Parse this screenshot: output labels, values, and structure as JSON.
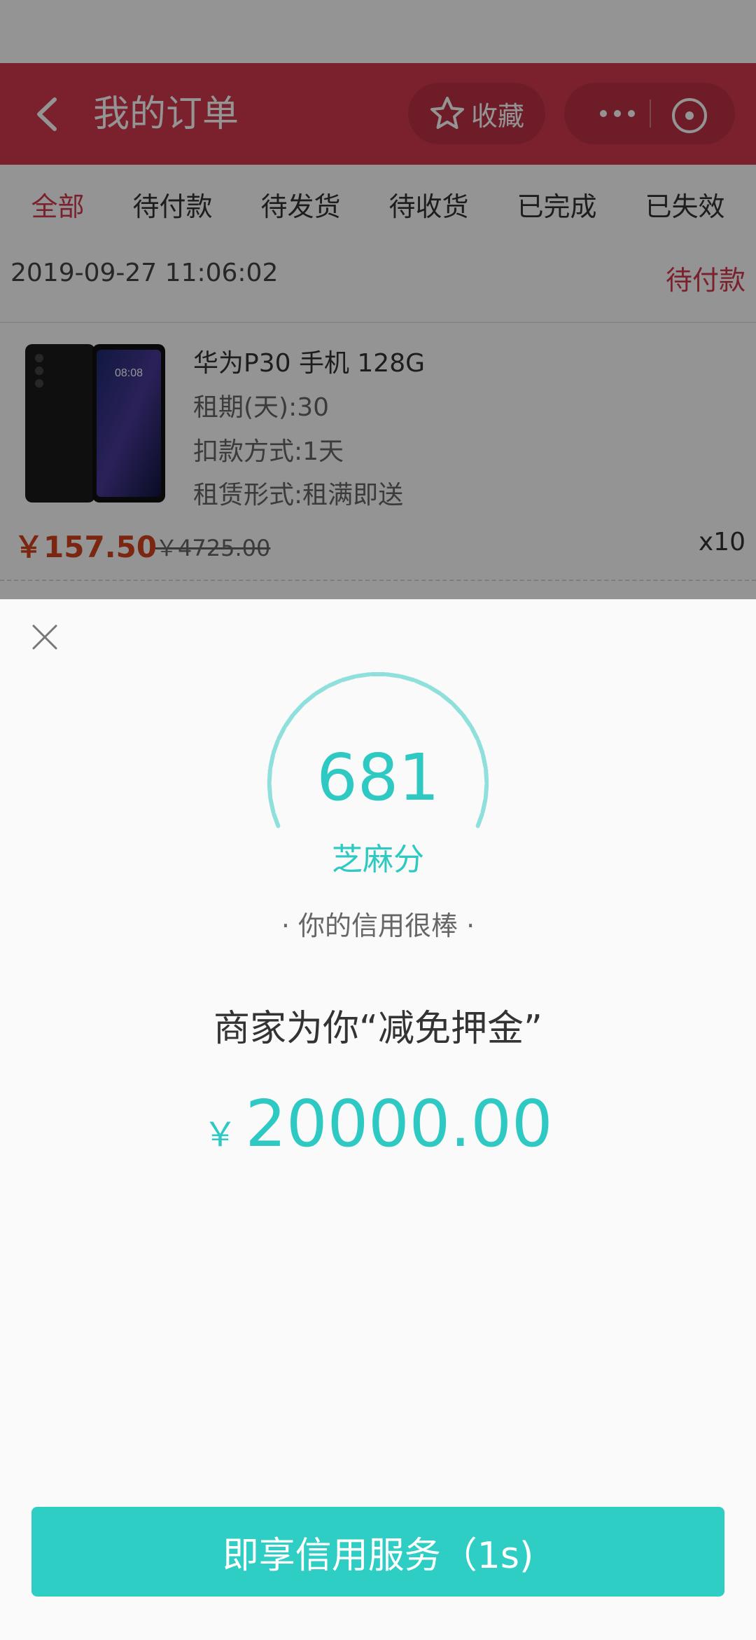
{
  "header": {
    "title": "我的订单",
    "favorite_label": "收藏",
    "color": "#d23a4f"
  },
  "tabs": [
    {
      "label": "全部",
      "active": true
    },
    {
      "label": "待付款",
      "active": false
    },
    {
      "label": "待发货",
      "active": false
    },
    {
      "label": "待收货",
      "active": false
    },
    {
      "label": "已完成",
      "active": false
    },
    {
      "label": "已失效",
      "active": false
    }
  ],
  "order": {
    "datetime": "2019-09-27 11:06:02",
    "status": "待付款",
    "product_name": "华为P30 手机 128G",
    "attributes": [
      "租期(天):30",
      "扣款方式:1天",
      "租赁形式:租满即送"
    ],
    "price": "￥157.50",
    "original_price": "￥4725.00",
    "quantity": "x10",
    "phone_time": "08:08"
  },
  "sheet": {
    "score": "681",
    "score_label": "芝麻分",
    "credit_text": "· 你的信用很棒 ·",
    "merchant_text": "商家为你“减免押金”",
    "currency": "￥",
    "amount": "20000.00",
    "button_label": "即享信用服务（1s)",
    "accent_color": "#2ec9c2"
  }
}
